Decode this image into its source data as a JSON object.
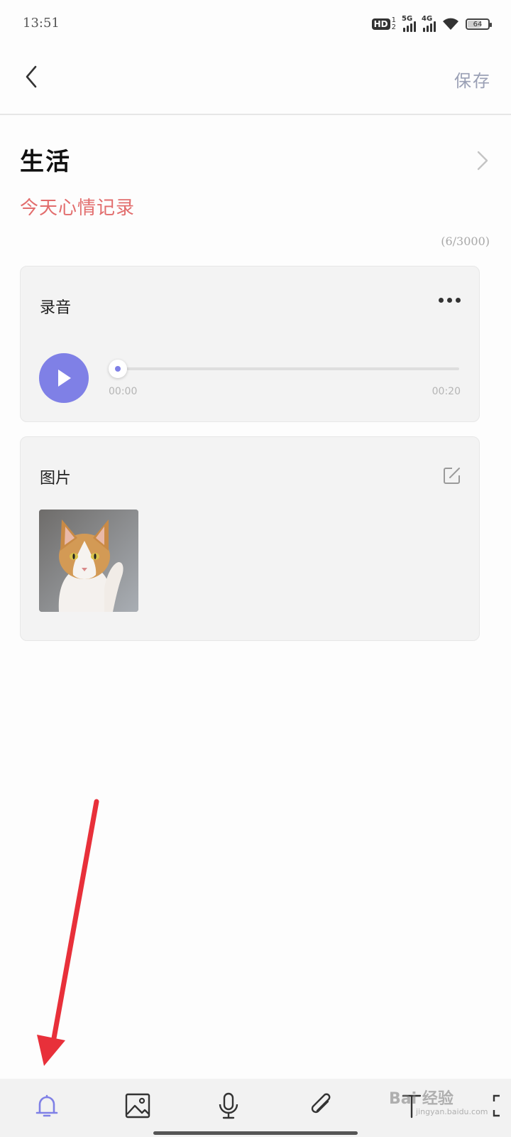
{
  "status_bar": {
    "time": "13:51",
    "hd_label": "HD",
    "hd_sup": "1",
    "hd_sub": "2",
    "net1": "5G",
    "net2": "4G",
    "battery_level": "64"
  },
  "header": {
    "back_icon": "chevron-left-icon",
    "save_label": "保存"
  },
  "note": {
    "category": "生活",
    "subtitle": "今天心情记录",
    "char_count": "(6/3000)"
  },
  "audio_card": {
    "title": "录音",
    "more_icon": "more-horizontal-icon",
    "play_icon": "play-icon",
    "current_time": "00:00",
    "duration": "00:20",
    "progress": 0.0
  },
  "image_card": {
    "title": "图片",
    "edit_icon": "edit-icon",
    "image_alt": "cat-photo"
  },
  "toolbar": {
    "items": [
      {
        "name": "reminder",
        "icon": "bell-icon"
      },
      {
        "name": "image",
        "icon": "image-icon"
      },
      {
        "name": "voice",
        "icon": "microphone-icon"
      },
      {
        "name": "attachment",
        "icon": "paperclip-icon"
      },
      {
        "name": "text-format",
        "icon": "text-icon"
      },
      {
        "name": "fullscreen",
        "icon": "expand-icon"
      }
    ]
  },
  "watermark": {
    "text": "Bai 经验",
    "sub": "jingyan.baidu.com"
  },
  "colors": {
    "accent": "#7f80e6",
    "subtitle": "#e26d6d",
    "save": "#9aa0b5",
    "annotation": "#e8303a"
  }
}
